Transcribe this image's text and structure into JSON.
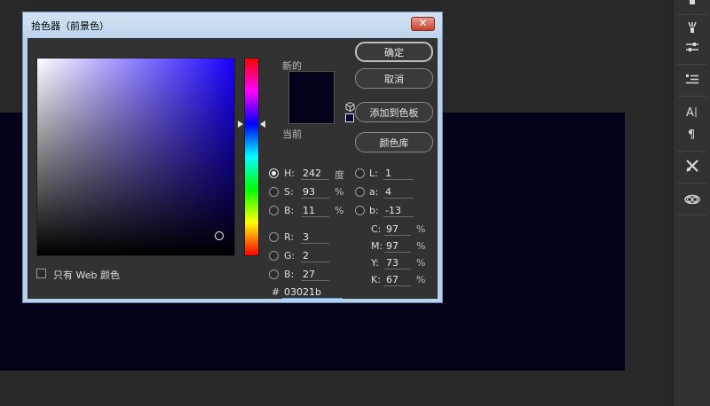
{
  "dialog": {
    "title": "拾色器（前景色）",
    "close_symbol": "✕"
  },
  "preview": {
    "new_label": "新的",
    "current_label": "当前",
    "new_color": "#03021b",
    "current_color": "#03021b"
  },
  "buttons": {
    "ok": "确定",
    "cancel": "取消",
    "add_to_swatches": "添加到色板",
    "color_libraries": "颜色库"
  },
  "hsb": [
    {
      "label": "H:",
      "value": "242",
      "unit": "度",
      "checked": true
    },
    {
      "label": "S:",
      "value": "93",
      "unit": "%",
      "checked": false
    },
    {
      "label": "B:",
      "value": "11",
      "unit": "%",
      "checked": false
    }
  ],
  "rgb": [
    {
      "label": "R:",
      "value": "3"
    },
    {
      "label": "G:",
      "value": "2"
    },
    {
      "label": "B:",
      "value": "27"
    }
  ],
  "lab": [
    {
      "label": "L:",
      "value": "1"
    },
    {
      "label": "a:",
      "value": "4"
    },
    {
      "label": "b:",
      "value": "-13"
    }
  ],
  "cmyk": [
    {
      "label": "C:",
      "value": "97",
      "unit": "%"
    },
    {
      "label": "M:",
      "value": "97",
      "unit": "%"
    },
    {
      "label": "Y:",
      "value": "73",
      "unit": "%"
    },
    {
      "label": "K:",
      "value": "67",
      "unit": "%"
    }
  ],
  "hex": {
    "label": "#",
    "value": "03021b"
  },
  "web_only": {
    "label": "只有 Web 颜色",
    "checked": false
  },
  "colors": {
    "canvas": "#03021b",
    "workspace": "#282828",
    "hue_selected": 242
  },
  "right_panel_icons": [
    "brush-settings-icon",
    "adjust-icon",
    "paragraph-style-icon",
    "character-icon",
    "paragraph-icon",
    "tools-icon",
    "cc-libraries-icon"
  ]
}
